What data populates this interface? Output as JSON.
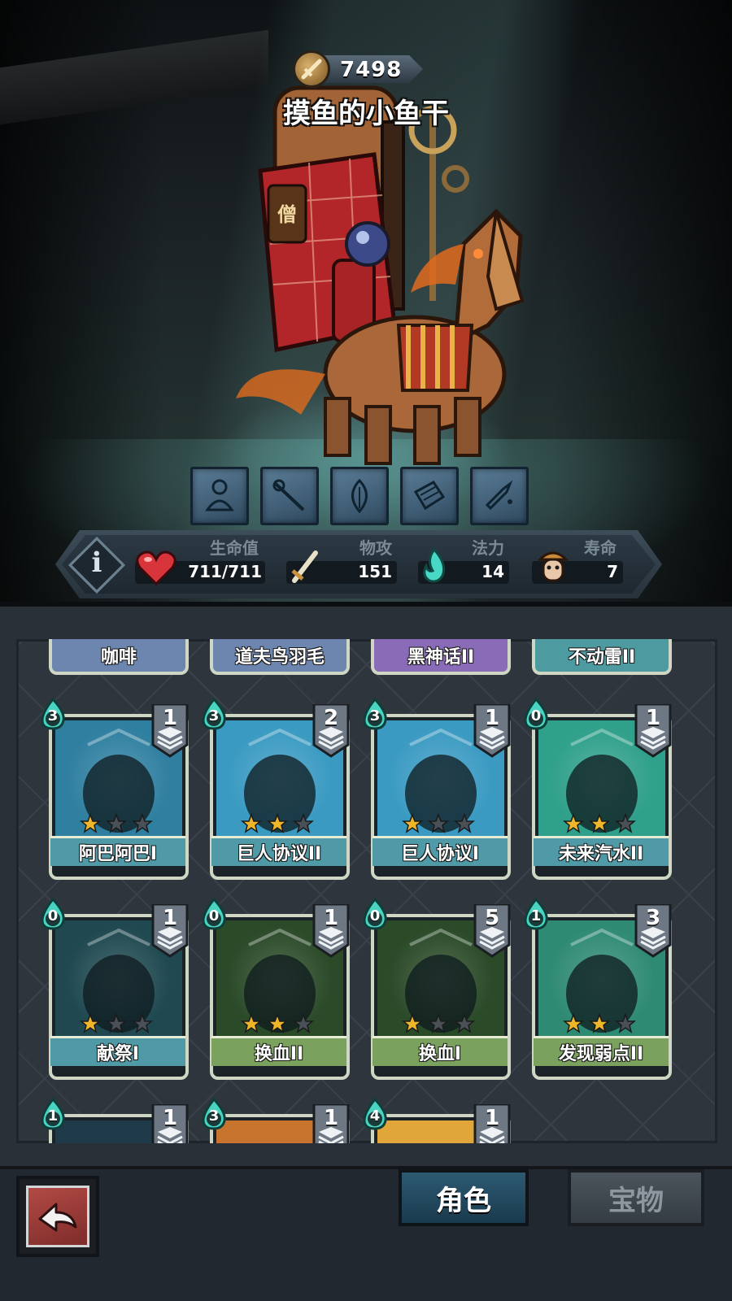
{
  "header": {
    "currency_value": "7498",
    "currency_icon": "sword-medal-icon",
    "player_name": "摸鱼的小鱼干"
  },
  "skills": [
    "meditating-monk-icon",
    "staff-icon",
    "leaf-flame-icon",
    "scroll-icon",
    "bullet-icon"
  ],
  "stats": {
    "hp": {
      "label": "生命值",
      "value": "711/711",
      "icon": "heart-icon"
    },
    "attack": {
      "label": "物攻",
      "value": "151",
      "icon": "sword-icon"
    },
    "mana": {
      "label": "法力",
      "value": "14",
      "icon": "flame-icon"
    },
    "lifespan": {
      "label": "寿命",
      "value": "7",
      "icon": "monk-face-icon"
    }
  },
  "top_row": [
    {
      "name": "咖啡",
      "color": "#6d86b0"
    },
    {
      "name": "道夫鸟羽毛",
      "color": "#6d86b0"
    },
    {
      "name": "黑神话II",
      "color": "#8a6bb8"
    },
    {
      "name": "不动雷II",
      "color": "#4d9aa0"
    }
  ],
  "cards": [
    {
      "name": "阿巴阿巴I",
      "cost": "3",
      "count": "1",
      "stars": 1,
      "bar": "#4f9aa6",
      "art": "#2f7fa0"
    },
    {
      "name": "巨人协议II",
      "cost": "3",
      "count": "2",
      "stars": 2,
      "bar": "#4f9aa6",
      "art": "#3a9ac2"
    },
    {
      "name": "巨人协议I",
      "cost": "3",
      "count": "1",
      "stars": 1,
      "bar": "#4f9aa6",
      "art": "#3a9ac2"
    },
    {
      "name": "未来汽水II",
      "cost": "0",
      "count": "1",
      "stars": 2,
      "bar": "#4f9aa6",
      "art": "#2fa08a"
    },
    {
      "name": "献祭I",
      "cost": "0",
      "count": "1",
      "stars": 1,
      "bar": "#4f9aa6",
      "art": "#1f4850"
    },
    {
      "name": "换血II",
      "cost": "0",
      "count": "1",
      "stars": 2,
      "bar": "#7aa25e",
      "art": "#2a4a28"
    },
    {
      "name": "换血I",
      "cost": "0",
      "count": "5",
      "stars": 1,
      "bar": "#7aa25e",
      "art": "#2a4a28"
    },
    {
      "name": "发现弱点II",
      "cost": "1",
      "count": "3",
      "stars": 2,
      "bar": "#7aa25e",
      "art": "#2f8a74"
    }
  ],
  "partial_row": [
    {
      "cost": "1",
      "count": "1",
      "art": "#1f3a48"
    },
    {
      "cost": "3",
      "count": "1",
      "art": "#c9742e"
    },
    {
      "cost": "4",
      "count": "1",
      "art": "#e0a63a"
    }
  ],
  "bottom": {
    "back_icon": "return-arrow-icon",
    "tab_character": "角色",
    "tab_treasure": "宝物"
  },
  "colors": {
    "accent": "#2d5a72",
    "panel": "#2a3038",
    "star_on": "#f0b62a",
    "star_off": "#4a5058"
  }
}
